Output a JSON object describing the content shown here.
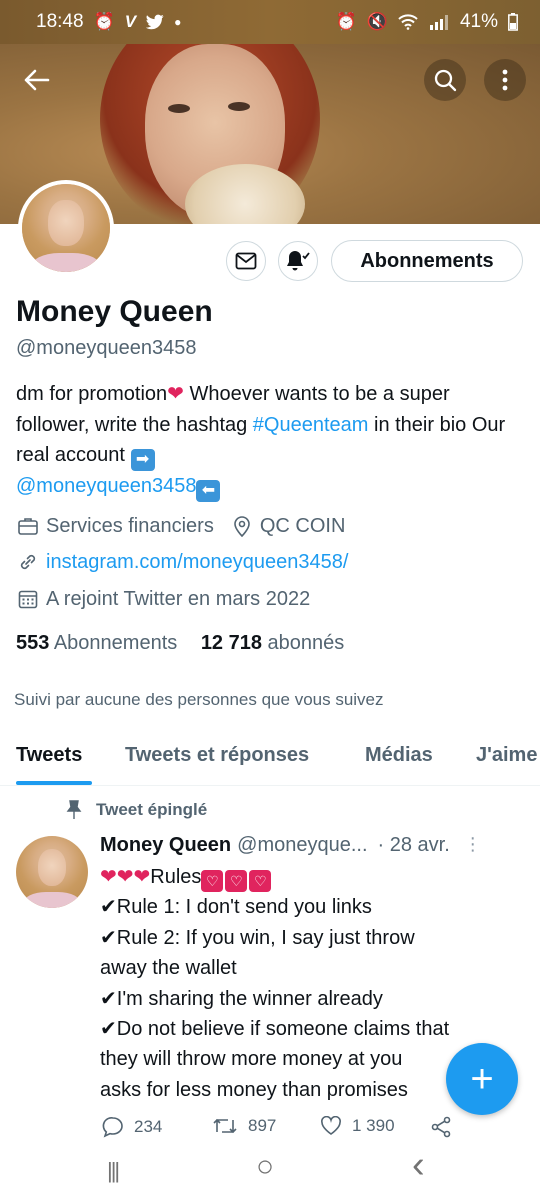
{
  "status_bar": {
    "time": "18:48",
    "left_icons": [
      "alarm-icon",
      "v-app-icon",
      "twitter-icon",
      "dot-icon"
    ],
    "right_icons": [
      "alarm-icon",
      "mute-icon",
      "wifi-icon",
      "volte-icon",
      "signal-icon"
    ],
    "battery": "41%"
  },
  "header": {
    "back_icon": "arrow-left-icon",
    "search_icon": "search-icon",
    "more_icon": "more-vertical-icon"
  },
  "profile": {
    "name": "Money Queen",
    "handle": "@moneyqueen3458",
    "follow_button_label": "Abonnements",
    "bio": {
      "part1": "dm for promotion",
      "part2": "  Whoever wants to be a super follower, write the hashtag ",
      "hashtag": "#Queenteam",
      "part3": " in their bio Our real account ",
      "account_link": "@moneyqueen3458"
    },
    "category": "Services financiers",
    "location": "QC COIN",
    "website": "instagram.com/moneyqueen3458/",
    "joined": "A rejoint Twitter en mars 2022",
    "following_count": "553",
    "following_label": "Abonnements",
    "followers_count": "12 718",
    "followers_label": "abonnés",
    "followed_by_text": "Suivi par aucune des personnes que vous suivez"
  },
  "tabs": [
    {
      "label": "Tweets",
      "active": true
    },
    {
      "label": "Tweets et réponses",
      "active": false
    },
    {
      "label": "Médias",
      "active": false
    },
    {
      "label": "J'aime",
      "active": false
    }
  ],
  "pinned_tweet": {
    "pinned_label": "Tweet épinglé",
    "author_name": "Money Queen",
    "author_handle": "@moneyque...",
    "date": "· 28 avr.",
    "more_symbol": "⋮",
    "lines": {
      "rules_title": "Rules",
      "l2": "✔Rule 1: I don't send you links",
      "l3": "✔Rule 2: If you win, I say just throw",
      "l4": "away the wallet",
      "l5": "✔I'm sharing the winner already",
      "l6": "✔Do not believe if someone claims that",
      "l7": "they will throw more money at you",
      "l8": "asks for less money than promises"
    },
    "replies": "234",
    "retweets": "897",
    "likes": "1 390"
  },
  "fab_label": "+",
  "nav": {
    "recents": "|||",
    "home": "○",
    "back": "‹"
  },
  "colors": {
    "accent": "#1d9bf0",
    "text_primary": "#0f1419",
    "text_secondary": "#536471",
    "heart": "#e0245e"
  }
}
